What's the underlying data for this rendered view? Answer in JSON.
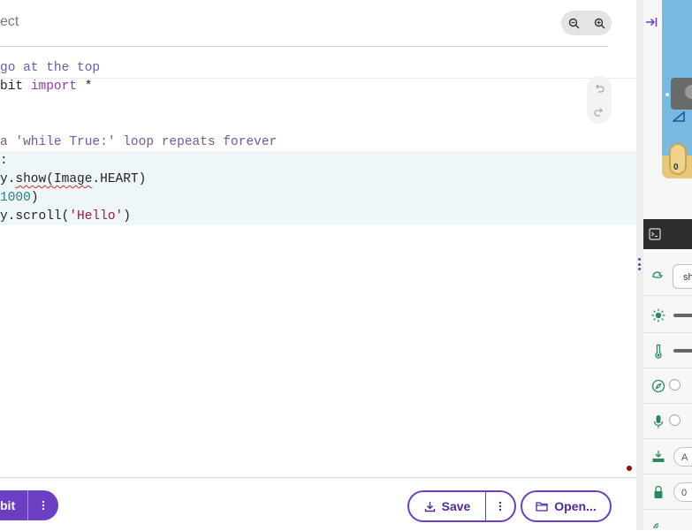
{
  "editor": {
    "project_title": "ect",
    "code_lines": [
      {
        "parts": [
          {
            "t": "go at the top",
            "c": "cm"
          }
        ]
      },
      {
        "parts": [
          {
            "t": "bit ",
            "c": ""
          },
          {
            "t": "import",
            "c": "kw"
          },
          {
            "t": " *",
            "c": ""
          }
        ]
      },
      {
        "parts": []
      },
      {
        "parts": []
      },
      {
        "parts": [
          {
            "t": "a 'while True:' loop repeats forever",
            "c": "cm"
          }
        ]
      },
      {
        "parts": [
          {
            "t": ":",
            "c": ""
          }
        ]
      },
      {
        "parts": [
          {
            "t": "y.",
            "c": ""
          },
          {
            "t": "show(Image",
            "c": "sq"
          },
          {
            "t": ".HEART)",
            "c": ""
          }
        ]
      },
      {
        "parts": [
          {
            "t": "1000",
            "c": "num"
          },
          {
            "t": ")",
            "c": ""
          }
        ]
      },
      {
        "parts": [
          {
            "t": "y.scroll(",
            "c": ""
          },
          {
            "t": "'Hello'",
            "c": "str"
          },
          {
            "t": ")",
            "c": ""
          }
        ]
      }
    ]
  },
  "bottom_bar": {
    "send_label": "bit",
    "save_label": "Save",
    "open_label": "Open..."
  },
  "simulator": {
    "board_pad_label": "0",
    "sound_select_value": "sh",
    "button_pill_label": "A",
    "pin_pill_label": "0",
    "colors": {
      "accent": "#6a3fc1",
      "sensor_icon": "#2a8a5c",
      "board_blue": "#78b9e2",
      "board_gold": "#e6c878"
    }
  },
  "icons": {
    "zoom_out": "zoom-out-icon",
    "zoom_in": "zoom-in-icon",
    "undo": "undo-icon",
    "redo": "redo-icon",
    "download": "download-icon",
    "folder": "folder-icon",
    "collapse": "collapse-right-icon",
    "terminal": "terminal-icon"
  }
}
